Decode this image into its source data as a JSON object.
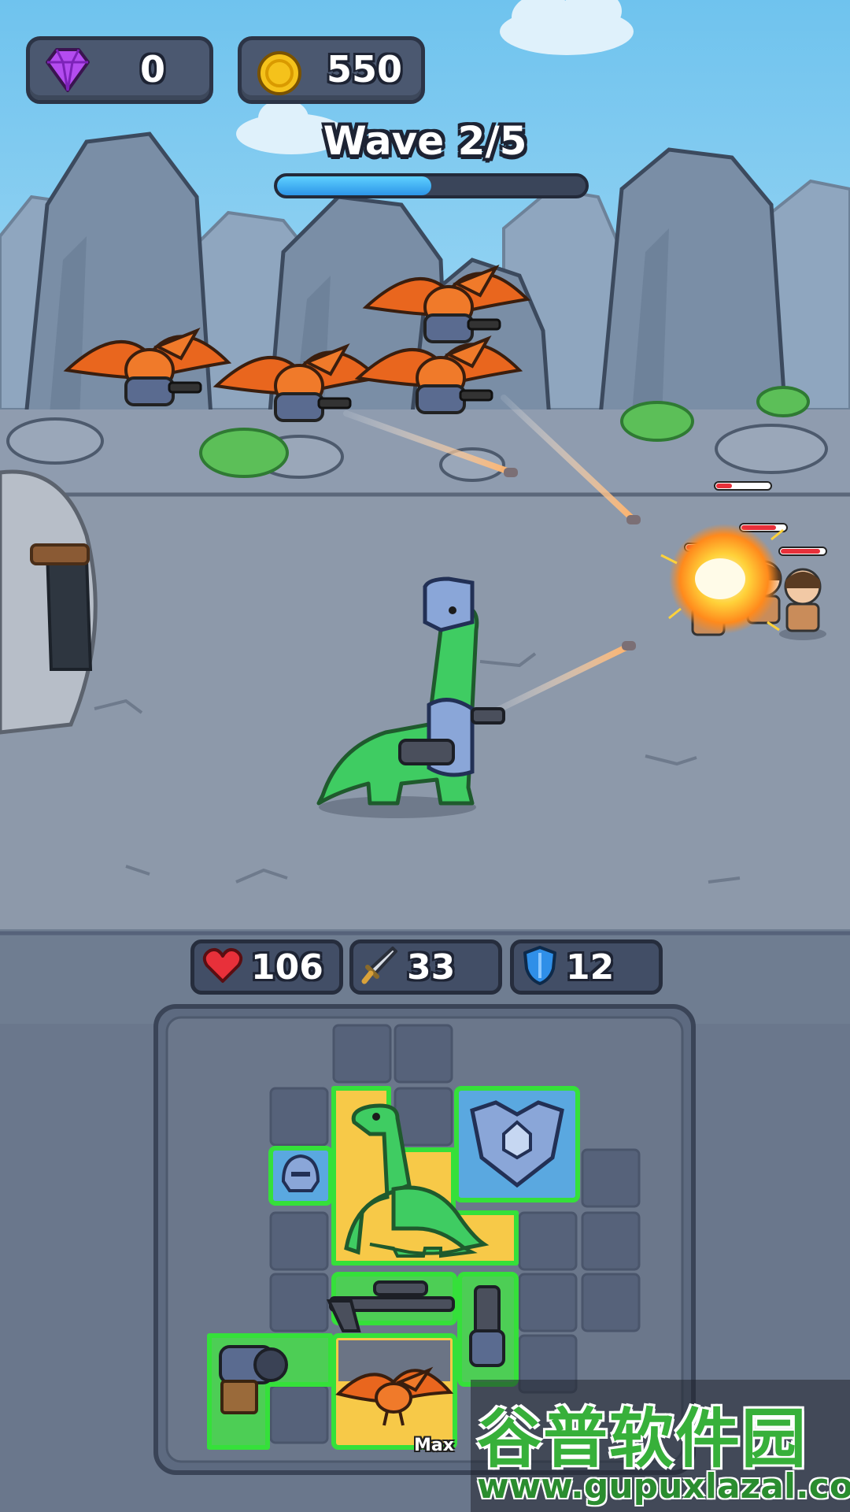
{
  "hud": {
    "gems": "0",
    "coins": "550",
    "wave_label": "Wave 2/5",
    "wave_progress": 0.5
  },
  "stats": {
    "health": "106",
    "attack": "33",
    "defense": "12"
  },
  "inventory": {
    "max_label": "Max"
  },
  "watermark": {
    "title": "谷普软件园",
    "url": "www.gupuxlazal.com"
  },
  "colors": {
    "gem": "#b44cf0",
    "coin": "#f5c21b",
    "health": "#e8303a",
    "shield": "#2f8fe8",
    "highlight_green": "#35e03a",
    "slot_yellow": "#f7c948",
    "dino_green": "#3fcc62",
    "pterodactyl_orange": "#e9661e"
  }
}
